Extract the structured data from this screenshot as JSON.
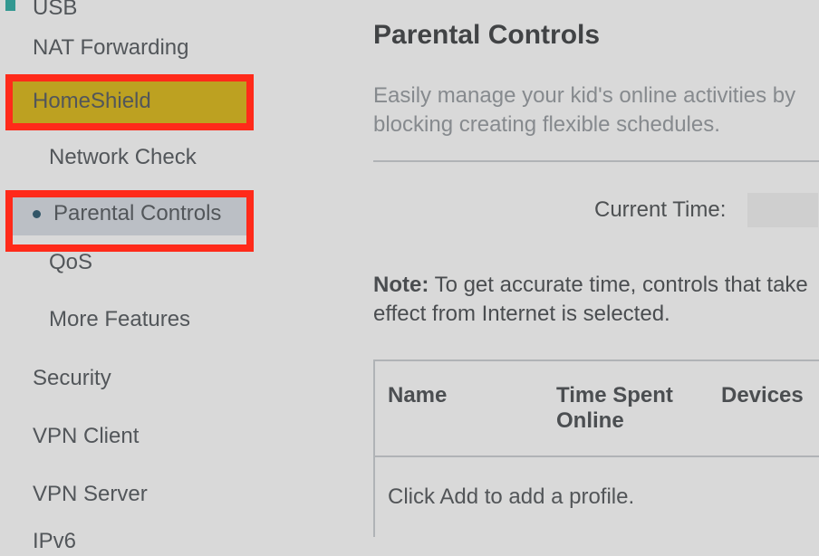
{
  "sidebar": {
    "items": [
      {
        "label": "USB"
      },
      {
        "label": "NAT Forwarding"
      },
      {
        "label": "HomeShield"
      },
      {
        "label": "Network Check"
      },
      {
        "label": "Parental Controls"
      },
      {
        "label": "QoS"
      },
      {
        "label": "More Features"
      },
      {
        "label": "Security"
      },
      {
        "label": "VPN Client"
      },
      {
        "label": "VPN Server"
      },
      {
        "label": "IPv6"
      }
    ]
  },
  "page": {
    "title": "Parental Controls",
    "description": "Easily manage your kid's online activities by blocking creating flexible schedules.",
    "current_time_label": "Current Time:",
    "current_time_value": "",
    "note_label": "Note:",
    "note_text": " To get accurate time, controls that take effect from Internet is selected."
  },
  "profiles_table": {
    "columns": {
      "name": "Name",
      "time": "Time Spent Online",
      "devices": "Devices"
    },
    "empty_message": "Click Add to add a profile."
  }
}
